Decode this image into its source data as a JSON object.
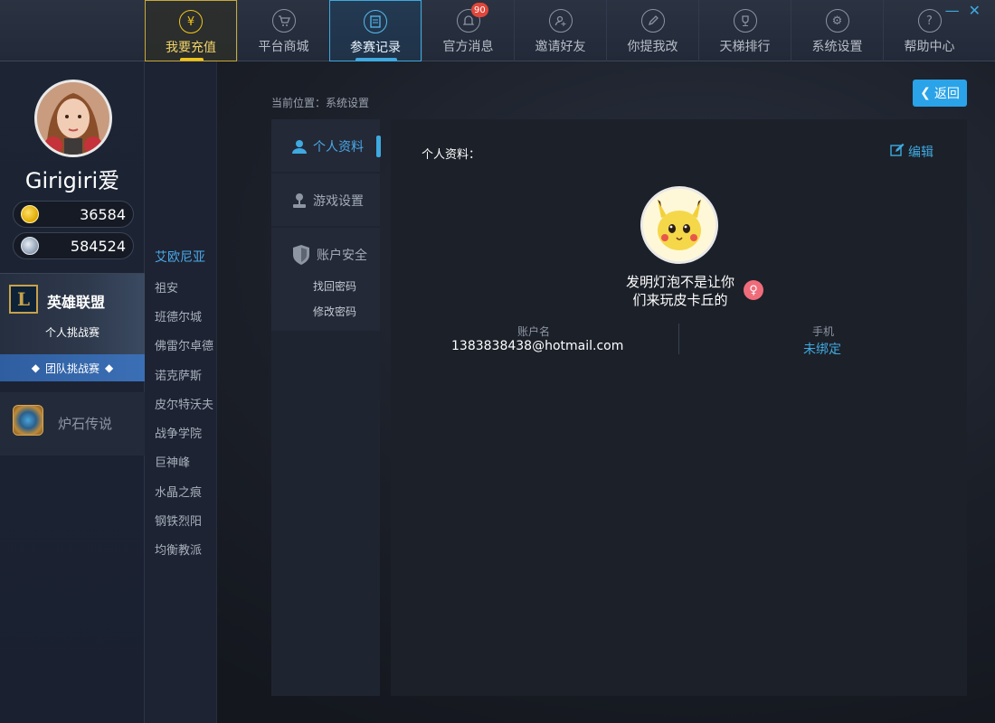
{
  "nav": {
    "items": [
      {
        "label": "我要充值",
        "icon": "yen-icon",
        "glyph": "¥"
      },
      {
        "label": "平台商城",
        "icon": "cart-icon",
        "glyph": "🛒"
      },
      {
        "label": "参赛记录",
        "icon": "document-icon",
        "glyph": "▤"
      },
      {
        "label": "官方消息",
        "icon": "bell-icon",
        "glyph": "♫",
        "badge": "90"
      },
      {
        "label": "邀请好友",
        "icon": "add-user-icon",
        "glyph": "+"
      },
      {
        "label": "你提我改",
        "icon": "pencil-icon",
        "glyph": "✎"
      },
      {
        "label": "天梯排行",
        "icon": "trophy-icon",
        "glyph": "♛"
      },
      {
        "label": "系统设置",
        "icon": "gear-icon",
        "glyph": "⚙"
      },
      {
        "label": "帮助中心",
        "icon": "question-icon",
        "glyph": "?"
      }
    ]
  },
  "window": {
    "minimize": "—",
    "close": "✕"
  },
  "user": {
    "name": "Girigiri爱",
    "gold": "36584",
    "silver": "584524"
  },
  "games": {
    "lol": {
      "name": "英雄联盟",
      "logo": "L",
      "sub": "个人挑战赛",
      "team": "团队挑战赛"
    },
    "hs": {
      "name": "炉石传说"
    }
  },
  "servers": [
    "艾欧尼亚",
    "祖安",
    "班德尔城",
    "佛雷尔卓德",
    "诺克萨斯",
    "皮尔特沃夫",
    "战争学院",
    "巨神峰",
    "水晶之痕",
    "钢铁烈阳",
    "均衡教派"
  ],
  "breadcrumb": "当前位置：系统设置",
  "back": "返回",
  "submenu": {
    "profile": "个人资料",
    "game": "游戏设置",
    "security": "账户安全",
    "find_pwd": "找回密码",
    "change_pwd": "修改密码"
  },
  "panel": {
    "title": "个人资料：",
    "edit": "编辑",
    "motto_line1": "发明灯泡不是让你",
    "motto_line2": "们来玩皮卡丘的",
    "account_label": "账户名",
    "account_value": "1383838438@hotmail.com",
    "phone_label": "手机",
    "phone_value": "未绑定"
  },
  "colors": {
    "accent": "#3fa9e0",
    "gold": "#f0c419",
    "female": "#f06c7a"
  }
}
